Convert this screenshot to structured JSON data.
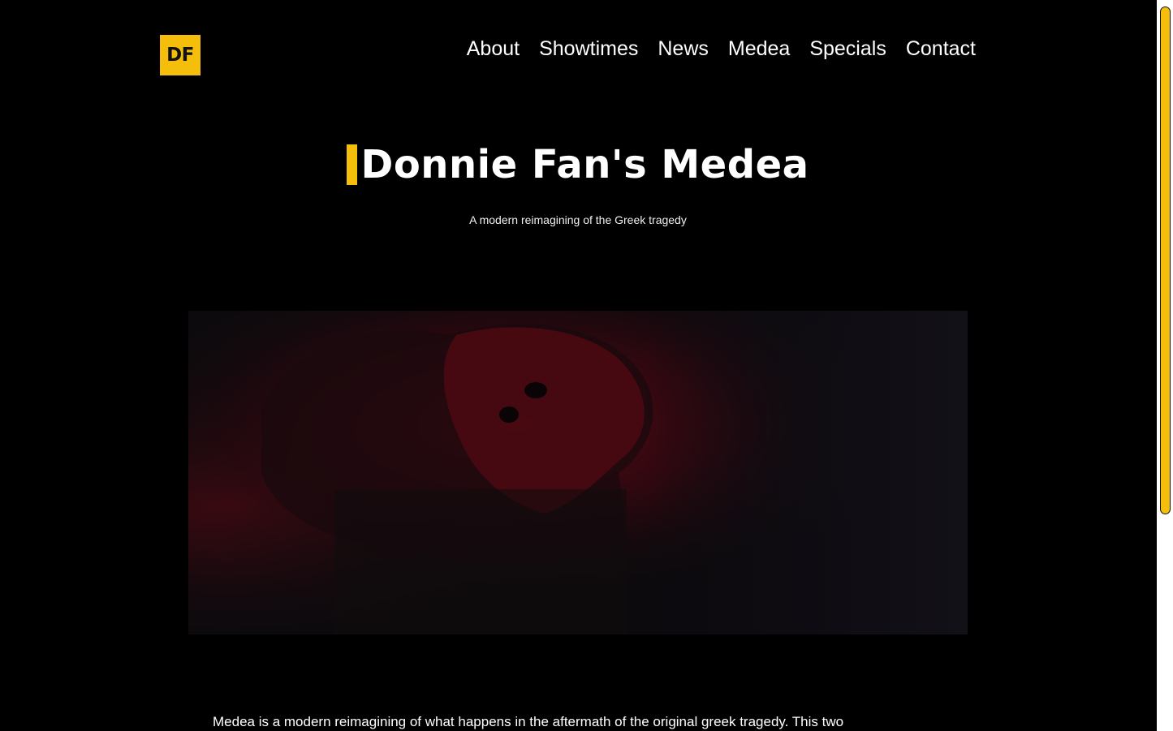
{
  "logo": {
    "text": "DF",
    "color": "#f5be0b"
  },
  "nav": {
    "items": [
      {
        "label": "About"
      },
      {
        "label": "Showtimes"
      },
      {
        "label": "News"
      },
      {
        "label": "Medea"
      },
      {
        "label": "Specials"
      },
      {
        "label": "Contact"
      }
    ]
  },
  "hero": {
    "title": "Donnie Fan's Medea",
    "subtitle": "A modern reimagining of the Greek tragedy",
    "accent_color": "#f5be0b"
  },
  "content": {
    "intro": "Medea is a modern reimagining of what happens in the aftermath of the original greek tragedy. This two"
  },
  "colors": {
    "background": "#000000",
    "accent": "#f5be0b",
    "text": "#ffffff"
  }
}
